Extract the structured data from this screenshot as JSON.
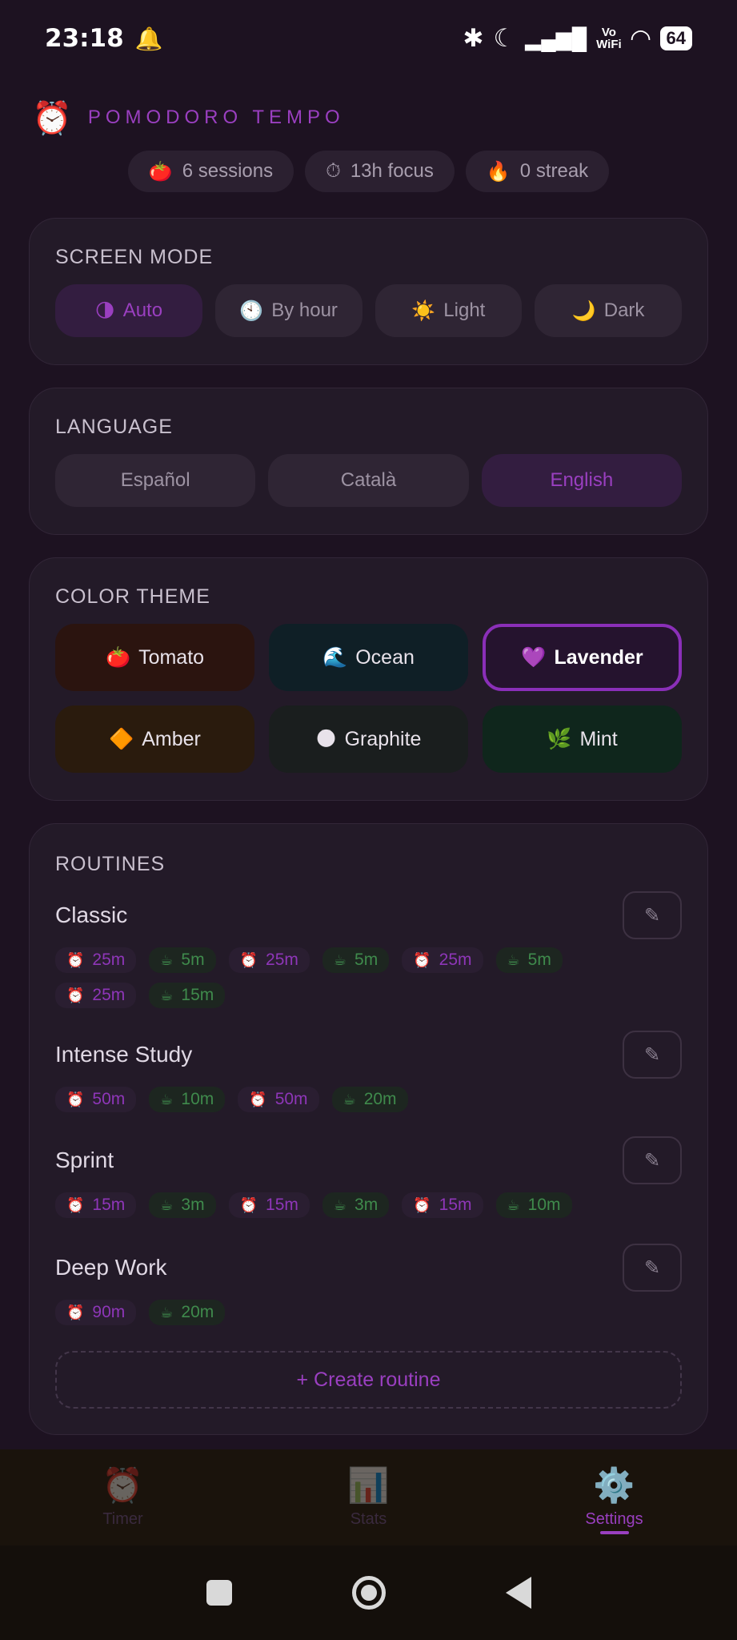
{
  "status_bar": {
    "time": "23:18",
    "battery": "64",
    "vowifi_top": "Vo",
    "vowifi_bottom": "WiFi"
  },
  "header": {
    "title": "POMODORO TEMPO"
  },
  "stats_chips": [
    {
      "icon": "🍅",
      "text": "6 sessions"
    },
    {
      "icon": "⏱",
      "text": "13h focus"
    },
    {
      "icon": "🔥",
      "text": "0 streak"
    }
  ],
  "screen_mode": {
    "title": "SCREEN MODE",
    "options": [
      {
        "icon": "🌗",
        "label": "Auto",
        "active": true
      },
      {
        "icon": "🕙",
        "label": "By hour",
        "active": false
      },
      {
        "icon": "☀️",
        "label": "Light",
        "active": false
      },
      {
        "icon": "🌙",
        "label": "Dark",
        "active": false
      }
    ]
  },
  "language": {
    "title": "LANGUAGE",
    "options": [
      {
        "label": "Español",
        "active": false
      },
      {
        "label": "Català",
        "active": false
      },
      {
        "label": "English",
        "active": true
      }
    ]
  },
  "color_theme": {
    "title": "COLOR THEME",
    "options": [
      {
        "icon": "🍅",
        "label": "Tomato",
        "bg": "#2b140f",
        "selected": false
      },
      {
        "icon": "🌊",
        "label": "Ocean",
        "bg": "#0f1f26",
        "selected": false
      },
      {
        "icon": "💜",
        "label": "Lavender",
        "bg": "#25132e",
        "selected": true
      },
      {
        "icon": "🔶",
        "label": "Amber",
        "bg": "#2a1b0d",
        "selected": false
      },
      {
        "icon": "🌑",
        "label": "Graphite",
        "bg": "#1a1e1e",
        "selected": false
      },
      {
        "icon": "🌿",
        "label": "Mint",
        "bg": "#0f261c",
        "selected": false
      }
    ]
  },
  "routines": {
    "title": "ROUTINES",
    "items": [
      {
        "name": "Classic",
        "steps": [
          {
            "type": "focus",
            "label": "25m"
          },
          {
            "type": "break",
            "label": "5m"
          },
          {
            "type": "focus",
            "label": "25m"
          },
          {
            "type": "break",
            "label": "5m"
          },
          {
            "type": "focus",
            "label": "25m"
          },
          {
            "type": "break",
            "label": "5m"
          },
          {
            "type": "focus",
            "label": "25m"
          },
          {
            "type": "break",
            "label": "15m"
          }
        ]
      },
      {
        "name": "Intense Study",
        "steps": [
          {
            "type": "focus",
            "label": "50m"
          },
          {
            "type": "break",
            "label": "10m"
          },
          {
            "type": "focus",
            "label": "50m"
          },
          {
            "type": "break",
            "label": "20m"
          }
        ]
      },
      {
        "name": "Sprint",
        "steps": [
          {
            "type": "focus",
            "label": "15m"
          },
          {
            "type": "break",
            "label": "3m"
          },
          {
            "type": "focus",
            "label": "15m"
          },
          {
            "type": "break",
            "label": "3m"
          },
          {
            "type": "focus",
            "label": "15m"
          },
          {
            "type": "break",
            "label": "10m"
          }
        ]
      },
      {
        "name": "Deep Work",
        "steps": [
          {
            "type": "focus",
            "label": "90m"
          },
          {
            "type": "break",
            "label": "20m"
          }
        ]
      }
    ],
    "create_label": "+ Create routine",
    "focus_icon": "⏰",
    "break_icon": "☕",
    "edit_icon": "✎"
  },
  "tabs": [
    {
      "icon": "⏰",
      "label": "Timer",
      "active": false
    },
    {
      "icon": "📊",
      "label": "Stats",
      "active": false
    },
    {
      "icon": "⚙️",
      "label": "Settings",
      "active": true
    }
  ],
  "accent_color": "#9a3fc0"
}
